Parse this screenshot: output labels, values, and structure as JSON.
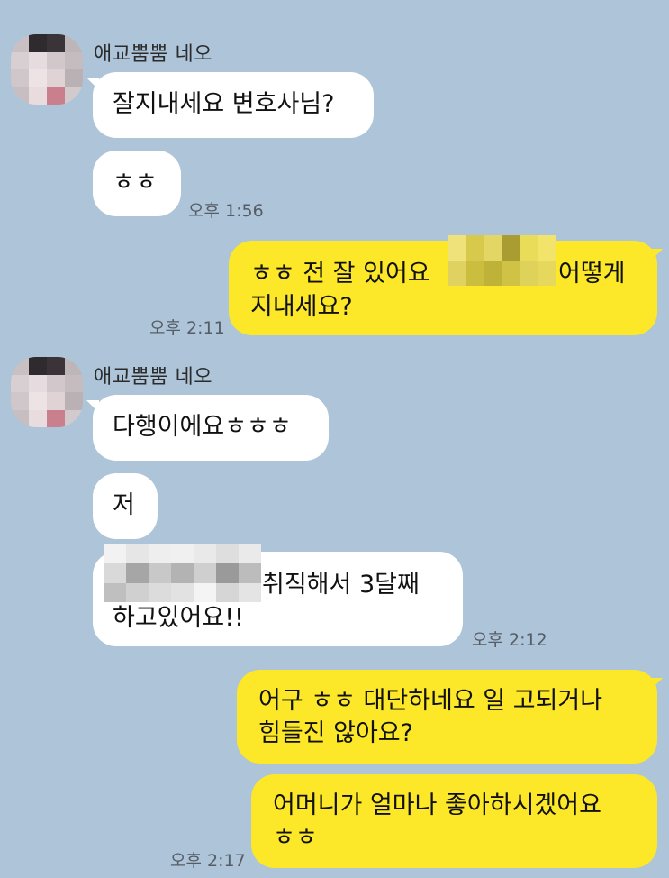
{
  "chat": {
    "messages": [
      {
        "sender_name": "애교뿜뿜 네오",
        "bubbles": [
          "잘지내세요 변호사님?",
          "ㅎㅎ"
        ],
        "time": "오후 1:56"
      },
      {
        "direction": "outgoing",
        "line1_prefix": "ㅎㅎ 전 잘 있어요",
        "line1_suffix": "어떻게",
        "line2": "지내세요?",
        "time": "오후 2:11"
      },
      {
        "sender_name": "애교뿜뿜 네오",
        "bubbles": [
          "다행이에요ㅎㅎㅎ",
          "저"
        ],
        "bubble3_line1_suffix": "취직해서 3달째",
        "bubble3_line2": "하고있어요!!",
        "time": "오후 2:12"
      },
      {
        "direction": "outgoing",
        "bubble1_line1": "어구 ㅎㅎ 대단하네요 일 고되거나",
        "bubble1_line2": "힘들진 않아요?",
        "bubble2_line1": "어머니가 얼마나 좋아하시겠어요",
        "bubble2_line2": "ㅎㅎ",
        "time": "오후 2:17"
      }
    ]
  },
  "colors": {
    "background": "#aec4d8",
    "incoming_bubble": "#ffffff",
    "outgoing_bubble": "#fce728"
  },
  "icons": {
    "avatar": "pixelated-profile-photo"
  }
}
